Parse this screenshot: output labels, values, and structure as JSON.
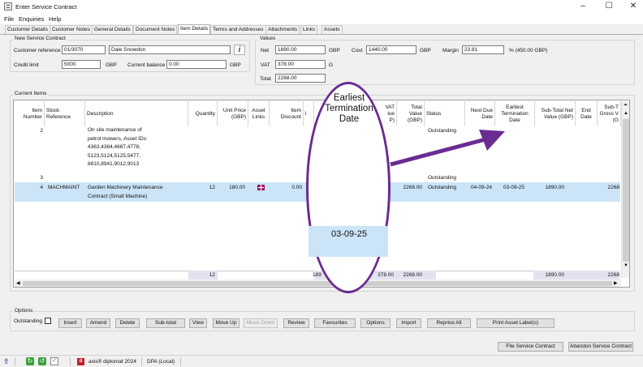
{
  "window": {
    "title": "Enter Service Contract",
    "controls": [
      "–",
      "☐",
      "✕"
    ]
  },
  "menu": [
    "File",
    "Enquiries",
    "Help"
  ],
  "tabs": [
    "Customer Details",
    "Customer Notes",
    "General Details",
    "Document Notes",
    "Item Details",
    "Terms and Addresses",
    "Attachments",
    "Links",
    "Assets"
  ],
  "active_tab": "Item Details",
  "new_contract": {
    "group_title": "New Service Contract",
    "customer_reference_label": "Customer reference",
    "customer_reference": "01/3070",
    "customer_name": "Dale Snowdon",
    "credit_limit_label": "Credit limit",
    "credit_limit": "5000",
    "credit_currency": "GBP",
    "current_balance_label": "Current balance",
    "current_balance": "0.00",
    "balance_currency": "GBP"
  },
  "values": {
    "group_title": "Values",
    "net_label": "Net",
    "net": "1890.00",
    "net_currency": "GBP",
    "cost_label": "Cost",
    "cost": "1440.00",
    "cost_currency": "GBP",
    "margin_label": "Margin",
    "margin": "23.81",
    "margin_suffix": "% (450.00 GBP)",
    "vat_label": "VAT",
    "vat": "378.00",
    "vat_currency_partial": "G",
    "total_label": "Total",
    "total": "2268.00"
  },
  "current_items": {
    "group_title": "Current Items",
    "headers": {
      "item_number": "Item Number",
      "stock_reference": "Stock Reference",
      "description": "Description",
      "quantity": "Quantity",
      "unit_price": "Unit Price (GBP)",
      "asset_links": "Asset Links",
      "item_discount": "Item Discount",
      "discount_partial": "l",
      "vat_value": "VAT lue P)",
      "total_value": "Total Value (GBP)",
      "status": "Status",
      "next_due_date": "Next Due Date",
      "earliest_termination_date": "Earliest Termination Date",
      "subtotal_net_value": "Sub-Total Net Value (GBP)",
      "end_date": "End Date",
      "subtotal_gross_value": "Sub-T Gross V (G"
    },
    "rows": [
      {
        "item_number": "2",
        "description_lines": [
          "On site maintenance of",
          "petrol mowers, Asset IDs:",
          "4363,4364,4687,4778,",
          "5123,5124,5125,5477,",
          "8810,8941,9012,9013"
        ],
        "status": "Outstanding"
      },
      {
        "item_number": "3",
        "status": "Outstanding"
      },
      {
        "item_number": "4",
        "stock_reference": "MACHMAINT",
        "description_lines": [
          "Garden Machinery Maintenance",
          "Contract (Small Machine)"
        ],
        "quantity": "12",
        "unit_price": "180.00",
        "item_discount": "0.00",
        "total_value": "2268.00",
        "status": "Outstanding",
        "next_due_date": "04-09-24",
        "earliest_termination_date": "03-09-25",
        "subtotal_net_value": "1890.00",
        "subtotal_gross_value": "2268"
      }
    ],
    "totals": {
      "quantity": "12",
      "discount_partial": "189",
      "vat": "378.00",
      "total_value": "2268.00",
      "subtotal_net": "1890.00",
      "subtotal_gross": "2268"
    }
  },
  "options": {
    "group_title": "Options",
    "outstanding_label": "Outstanding",
    "outstanding_checked": false,
    "buttons": [
      "Insert",
      "Amend",
      "Delete",
      "Sub-total",
      "View",
      "Move Up",
      "Move Down",
      "Review",
      "Favourites",
      "Options",
      "Import",
      "Reprice All",
      "Print Asset Label(s)"
    ],
    "disabled_buttons": [
      "Move Down"
    ]
  },
  "footer_buttons": {
    "file": "File Service Contract",
    "abandon": "Abandon Service Contract"
  },
  "statusbar": {
    "product": "axis® diplomat 2024",
    "database": "DPA (Local)"
  },
  "annotation": {
    "title": "Earliest Termination Date",
    "value": "03-09-25",
    "color": "#6a2c91"
  },
  "colors": {
    "selection": "#cce4f7",
    "annotation": "#6a2c91",
    "info_icon": "#6a2c91"
  }
}
